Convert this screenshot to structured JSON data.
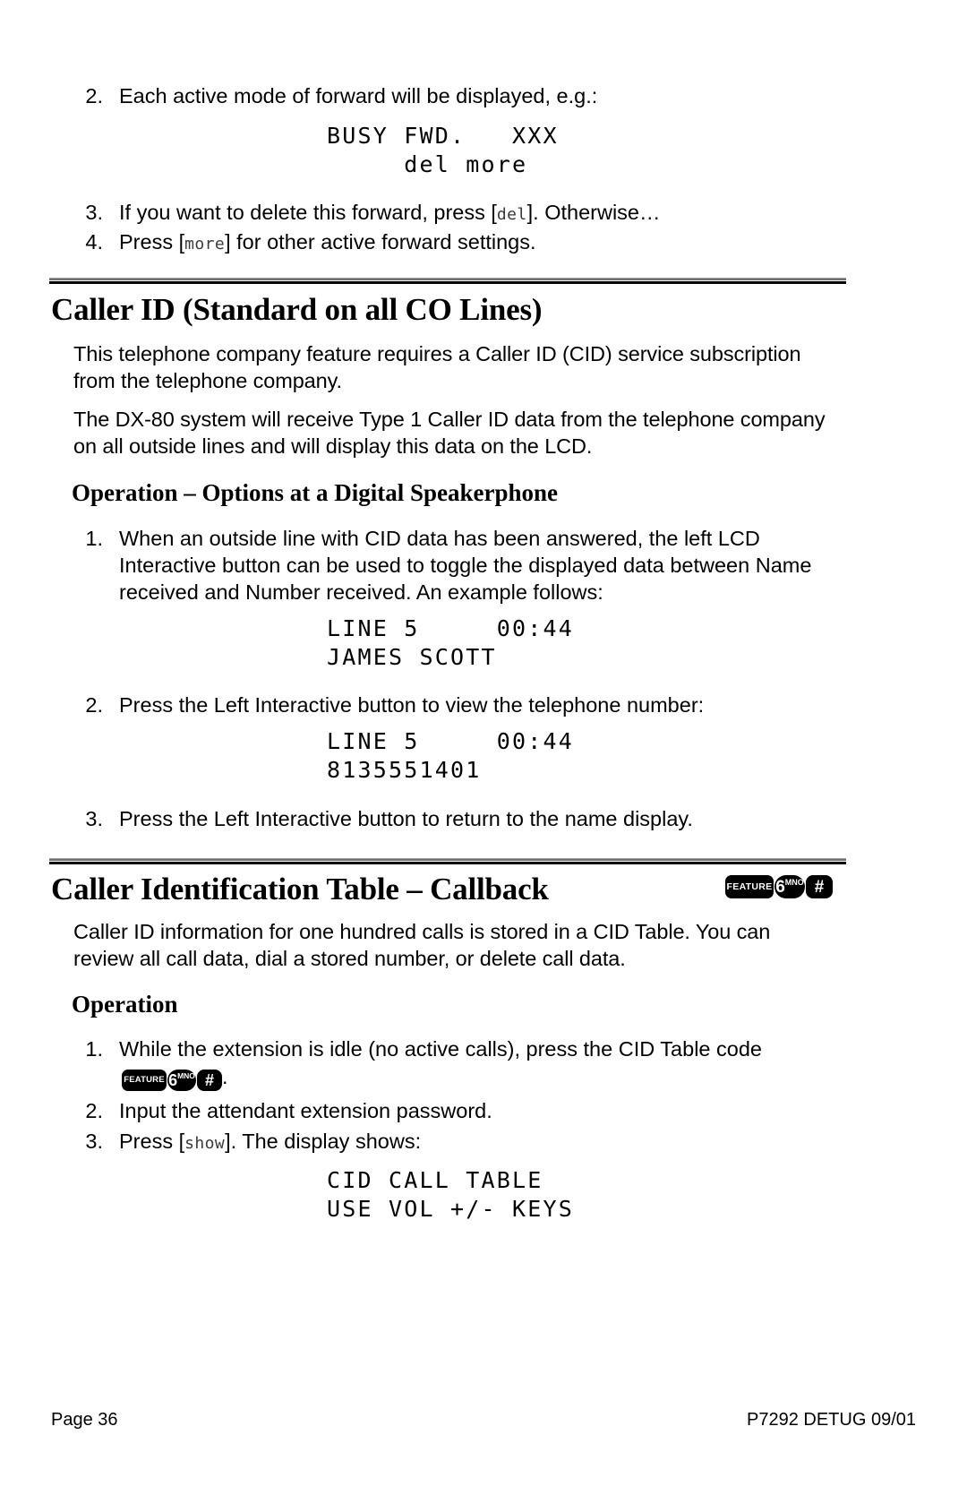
{
  "document": {
    "page_label": "Page 36",
    "doc_code": "P7292 DETUG 09/01"
  },
  "top_section": {
    "steps": [
      {
        "number": "2.",
        "text": "Each active mode of forward will be displayed, e.g.:"
      }
    ],
    "lcd_1": {
      "line1": "BUSY FWD.   XXX",
      "line2": "     del more"
    },
    "steps_after": [
      {
        "number": "3.",
        "pre": "If you want to delete this forward, press [",
        "key": "del",
        "post": "]. Otherwise…"
      },
      {
        "number": "4.",
        "pre": "Press [",
        "key": "more",
        "post": "] for other active forward settings."
      }
    ]
  },
  "section_caller_id": {
    "heading": "Caller ID (Standard on all CO Lines)",
    "paragraph_1": "This telephone company feature requires a Caller ID (CID) service subscription from the telephone company.",
    "paragraph_2": "The DX-80 system will receive Type 1 Caller ID data from the telephone company on all outside lines and will display this data on the LCD.",
    "subheading": "Operation – Options at a Digital Speakerphone",
    "steps": [
      {
        "number": "1.",
        "text": "When an outside line with CID data has been answered, the left LCD Interactive button can be used to toggle the displayed data between Name received and Number received. An example follows:"
      },
      {
        "number": "2.",
        "text": "Press the Left Interactive button to view the telephone number:"
      },
      {
        "number": "3.",
        "text": "Press the Left Interactive button to return to the name display."
      }
    ],
    "lcd_name": {
      "line1": "LINE 5     00:44",
      "line2": "JAMES SCOTT"
    },
    "lcd_number": {
      "line1": "LINE 5     00:44",
      "line2": "8135551401"
    }
  },
  "section_cid_table": {
    "heading": "Caller Identification Table – Callback",
    "heading_keys": [
      {
        "type": "feature",
        "label": "FEATURE"
      },
      {
        "type": "digit",
        "digit": "6",
        "letters": "MNO"
      },
      {
        "type": "hash",
        "glyph": "#"
      }
    ],
    "paragraph": "Caller ID information for one hundred calls is stored in a CID Table.  You can review all call data, dial a stored number, or delete call data.",
    "subheading": "Operation",
    "steps": [
      {
        "number": "1.",
        "text": "While the extension is idle (no active calls), press the CID Table code",
        "trailing_period": "."
      },
      {
        "number": "2.",
        "text": "Input the attendant extension password."
      },
      {
        "number": "3.",
        "pre": "Press [",
        "key": "show",
        "post": "]. The display shows:"
      }
    ],
    "step_keys": [
      {
        "type": "feature",
        "label": "FEATURE"
      },
      {
        "type": "digit",
        "digit": "6",
        "letters": "MNO"
      },
      {
        "type": "hash",
        "glyph": "#"
      }
    ],
    "lcd": {
      "line1": "CID CALL TABLE",
      "line2": "USE VOL +/- KEYS"
    }
  }
}
